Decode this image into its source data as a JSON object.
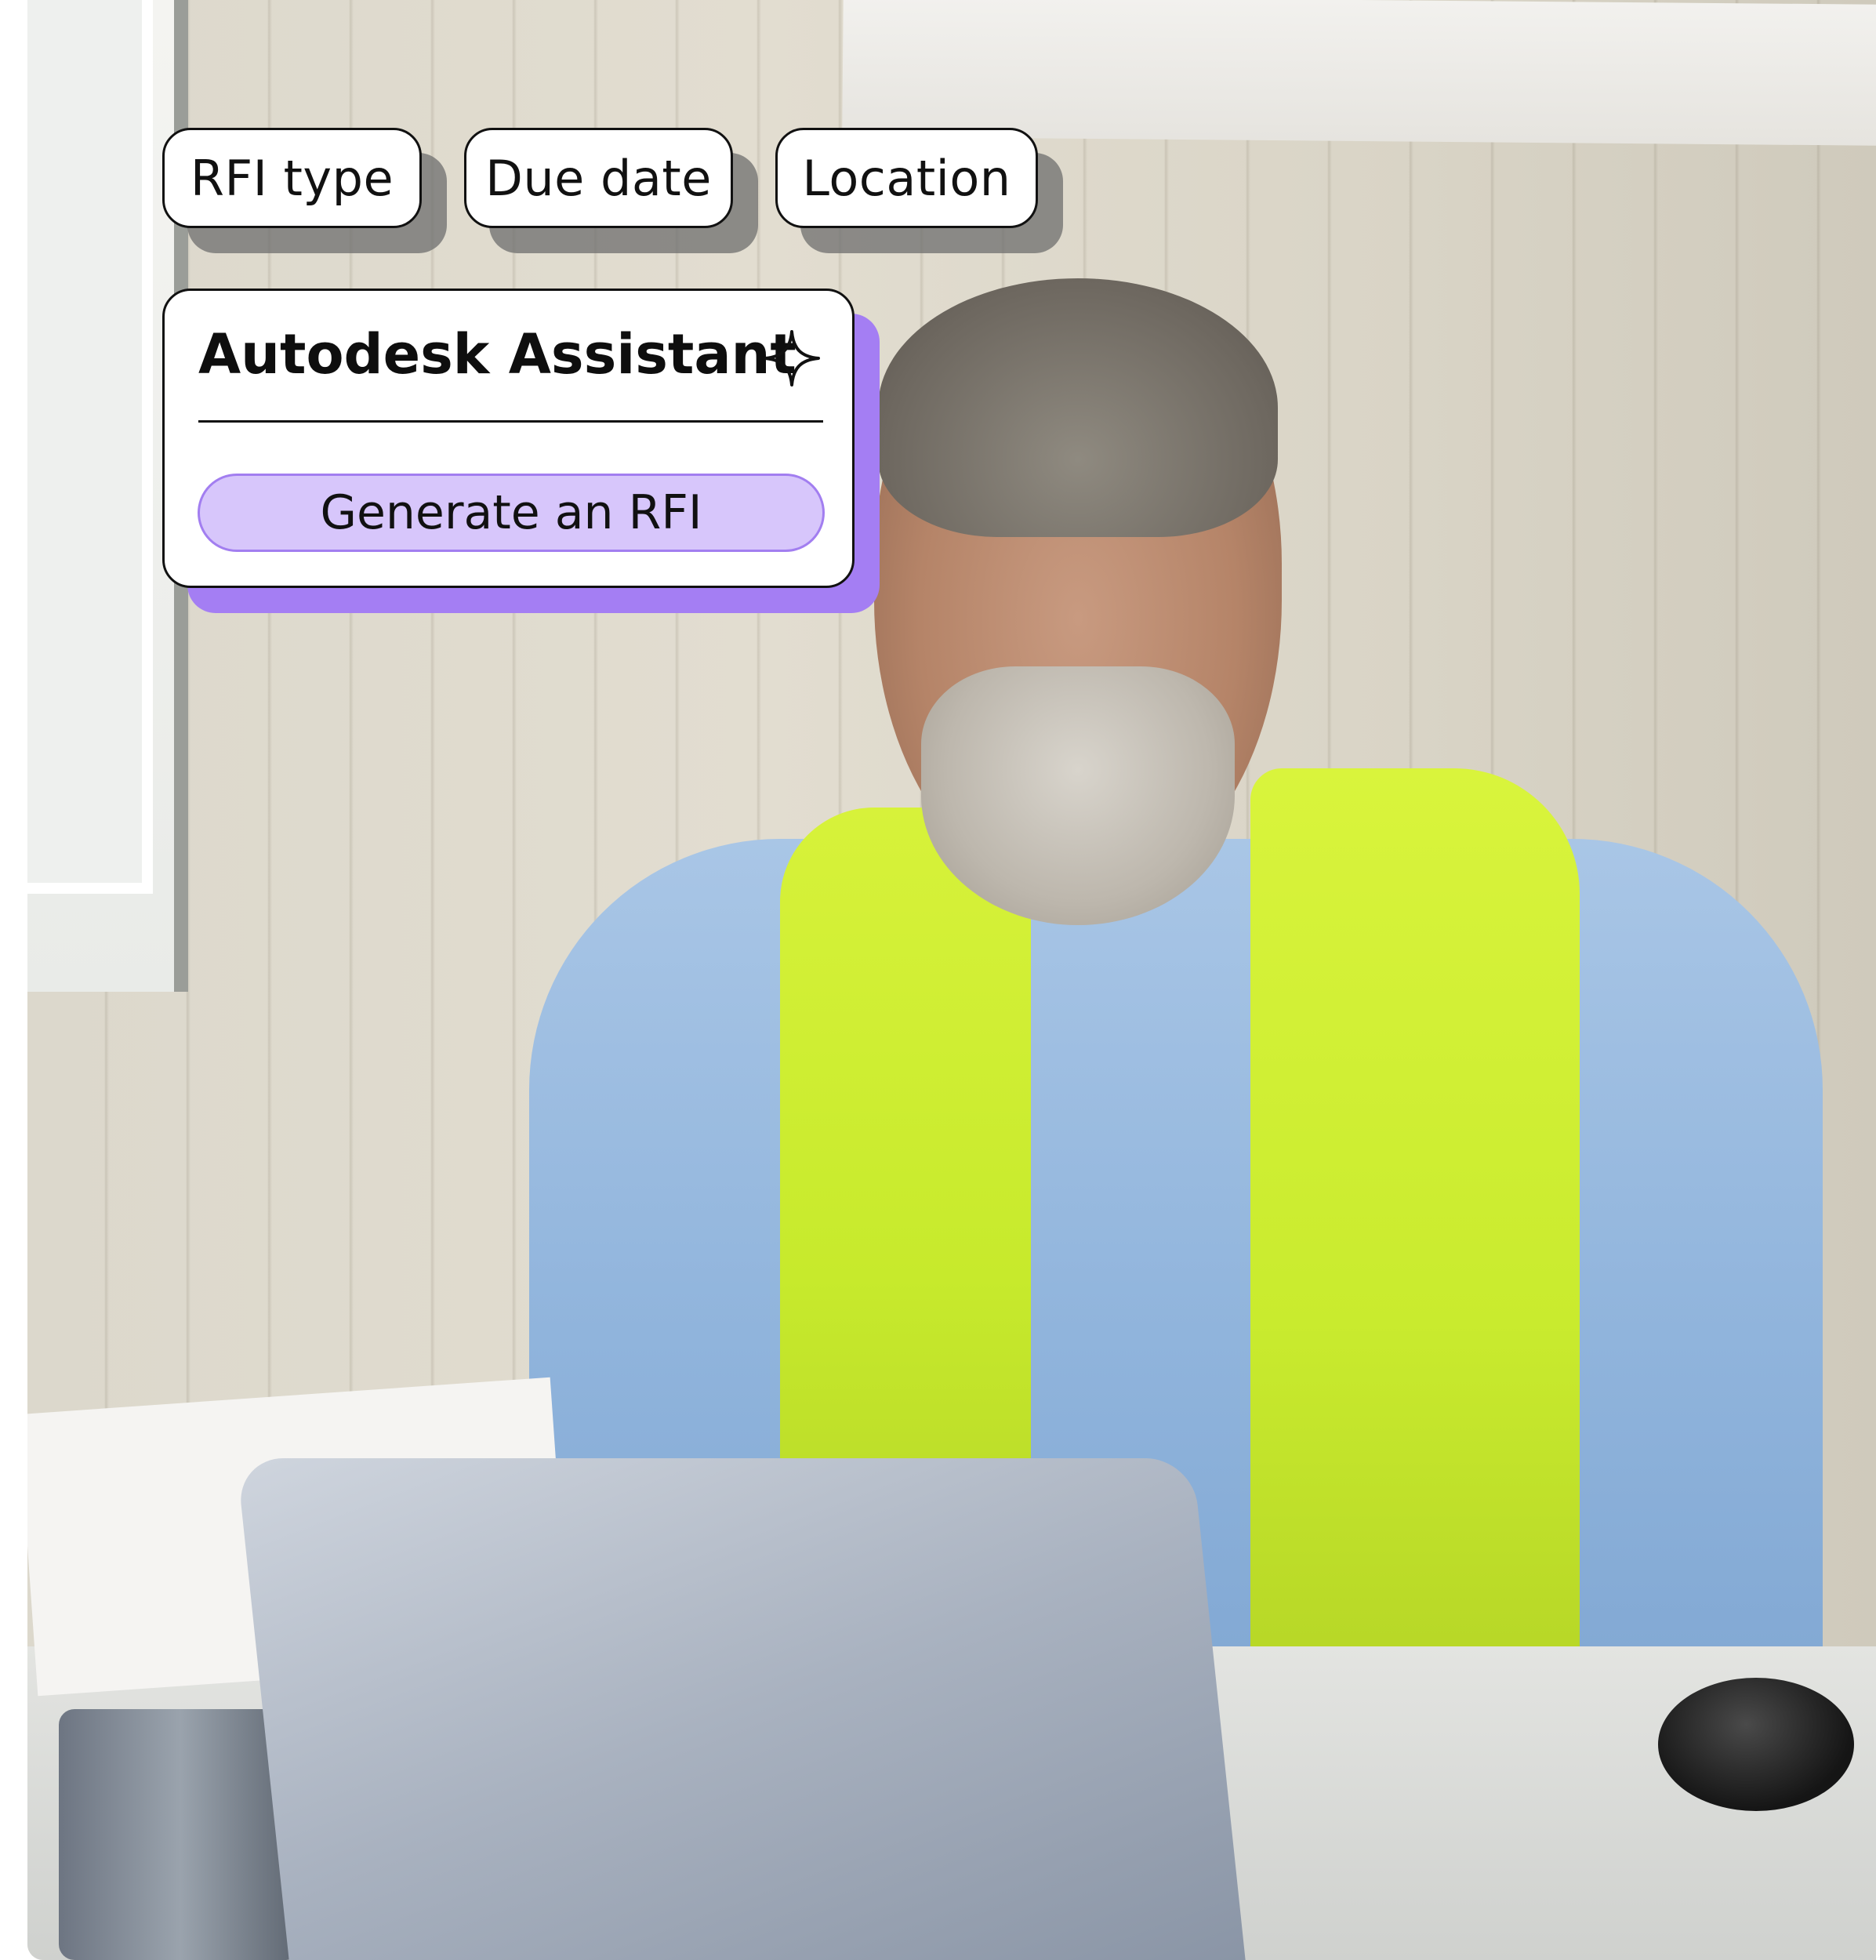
{
  "chips": [
    {
      "label": "RFI type"
    },
    {
      "label": "Due date"
    },
    {
      "label": "Location"
    }
  ],
  "assistant": {
    "title": "Autodesk Assistant",
    "icon": "sparkle-icon",
    "action_label": "Generate an RFI"
  },
  "colors": {
    "accent_purple": "#a47ef3",
    "button_fill": "#d7c6fb",
    "chip_shadow": "#6e6e6e",
    "text": "#111111"
  }
}
